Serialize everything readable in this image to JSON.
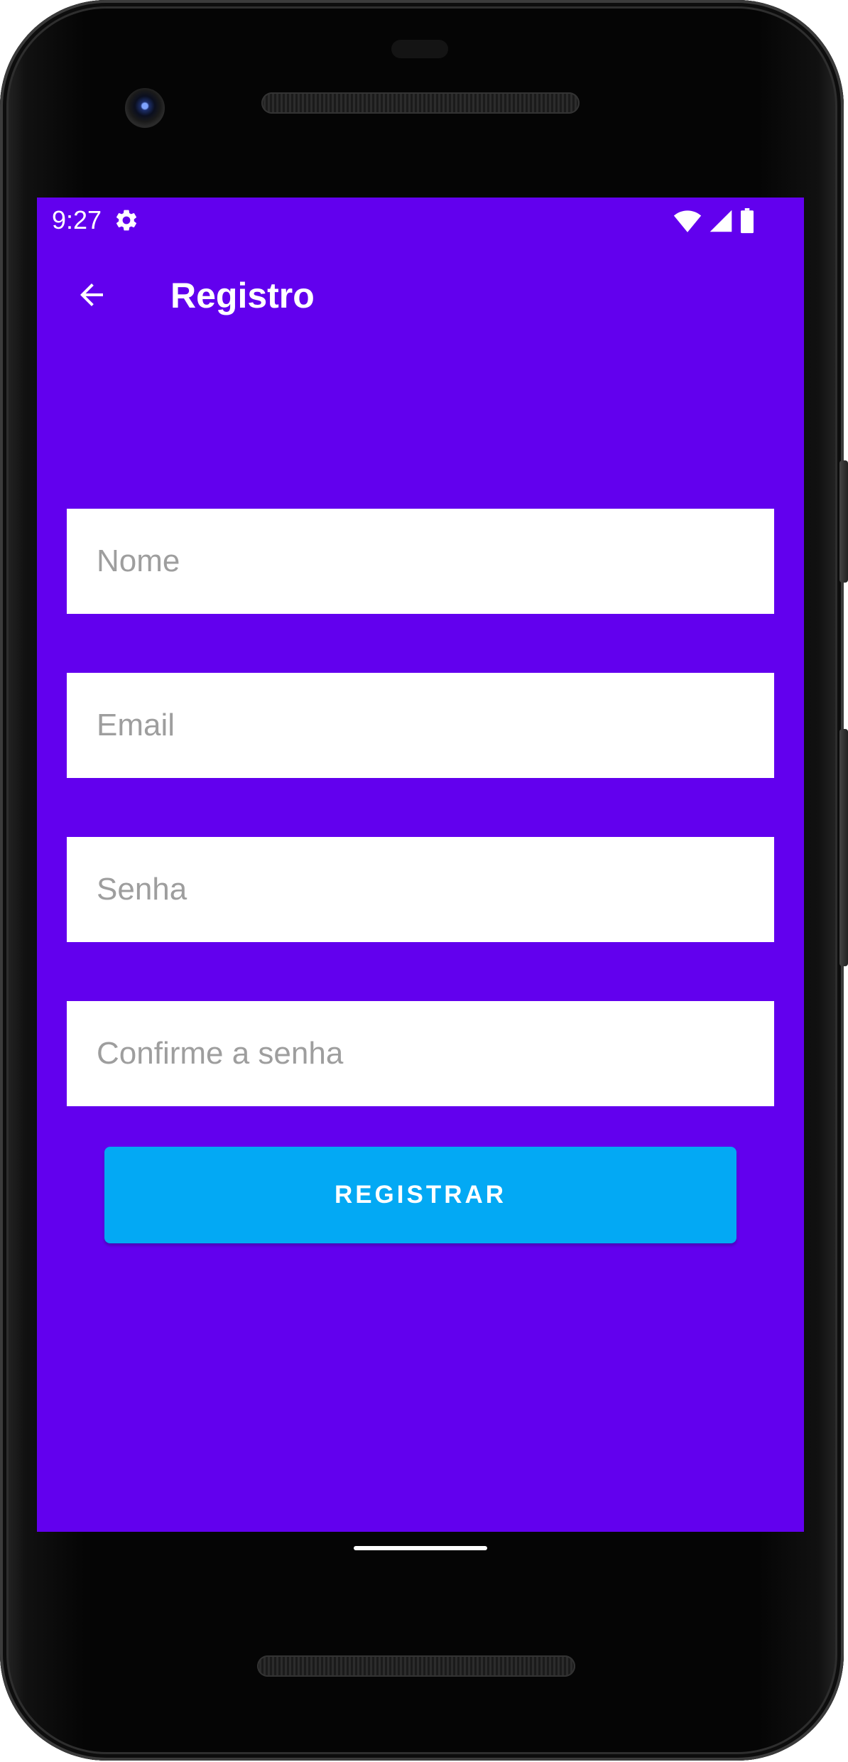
{
  "status_bar": {
    "time": "9:27",
    "icons": [
      "settings-icon",
      "wifi-icon",
      "cell-signal-icon",
      "battery-icon"
    ]
  },
  "toolbar": {
    "back_icon": "arrow-back-icon",
    "title": "Registro"
  },
  "form": {
    "nome_placeholder": "Nome",
    "email_placeholder": "Email",
    "senha_placeholder": "Senha",
    "confirm_placeholder": "Confirme a senha",
    "register_label": "REGISTRAR"
  },
  "colors": {
    "primary": "#6200ee",
    "button": "#03a9f4",
    "field_background": "#ffffff",
    "placeholder_text": "#9e9e9e"
  }
}
